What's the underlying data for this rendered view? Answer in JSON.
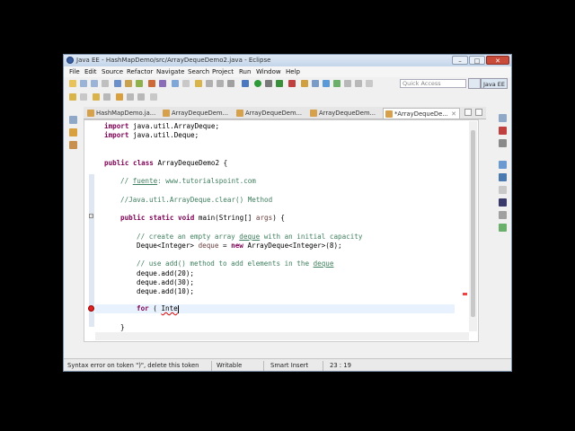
{
  "window": {
    "title": "Java EE - HashMapDemo/src/ArrayDequeDemo2.java - Eclipse",
    "minimize": "–",
    "maximize": "□",
    "close": "✕"
  },
  "menu": [
    "File",
    "Edit",
    "Source",
    "Refactor",
    "Navigate",
    "Search",
    "Project",
    "Run",
    "Window",
    "Help"
  ],
  "quick_access": {
    "placeholder": "Quick Access"
  },
  "perspective": {
    "label": "Java EE"
  },
  "tabs": [
    {
      "label": "HashMapDemo.ja..."
    },
    {
      "label": "ArrayDequeDem..."
    },
    {
      "label": "ArrayDequeDem..."
    },
    {
      "label": "ArrayDequeDem..."
    },
    {
      "label": "*ArrayDequeDe..."
    }
  ],
  "code": {
    "l1_kw": "import",
    "l1_rest": " java.util.ArrayDeque;",
    "l2_kw": "import",
    "l2_rest": " java.util.Deque;",
    "l3_kw1": "public",
    "l3_kw2": "class",
    "l3_rest": " ArrayDequeDemo2 {",
    "l4_a": "// ",
    "l4_b": "fuente",
    "l4_c": ": www.tutorialspoint.com",
    "l5": "//Java.util.ArrayDeque.clear() Method",
    "l6_kw1": "public",
    "l6_kw2": "static",
    "l6_kw3": "void",
    "l6_rest": " main(String[] ",
    "l6_args": "args",
    "l6_end": ") {",
    "l7_a": "// create an empty array ",
    "l7_b": "deque",
    "l7_c": " with an initial capacity",
    "l8_a": "Deque<Integer> ",
    "l8_b": "deque",
    "l8_c": " = ",
    "l8_kw": "new",
    "l8_d": " ArrayDeque<Integer>(8);",
    "l9_a": "// use add() method to add elements in the ",
    "l9_b": "deque",
    "l10": "deque.add(20);",
    "l11": "deque.add(30);",
    "l12": "deque.add(10);",
    "l13_kw": "for",
    "l13_a": " ( ",
    "l13_b": "Inte",
    "l14": "}"
  },
  "status": {
    "message": "Syntax error on token \")\", delete this token",
    "mode": "Writable",
    "insert": "Smart Insert",
    "position": "23 : 19"
  }
}
